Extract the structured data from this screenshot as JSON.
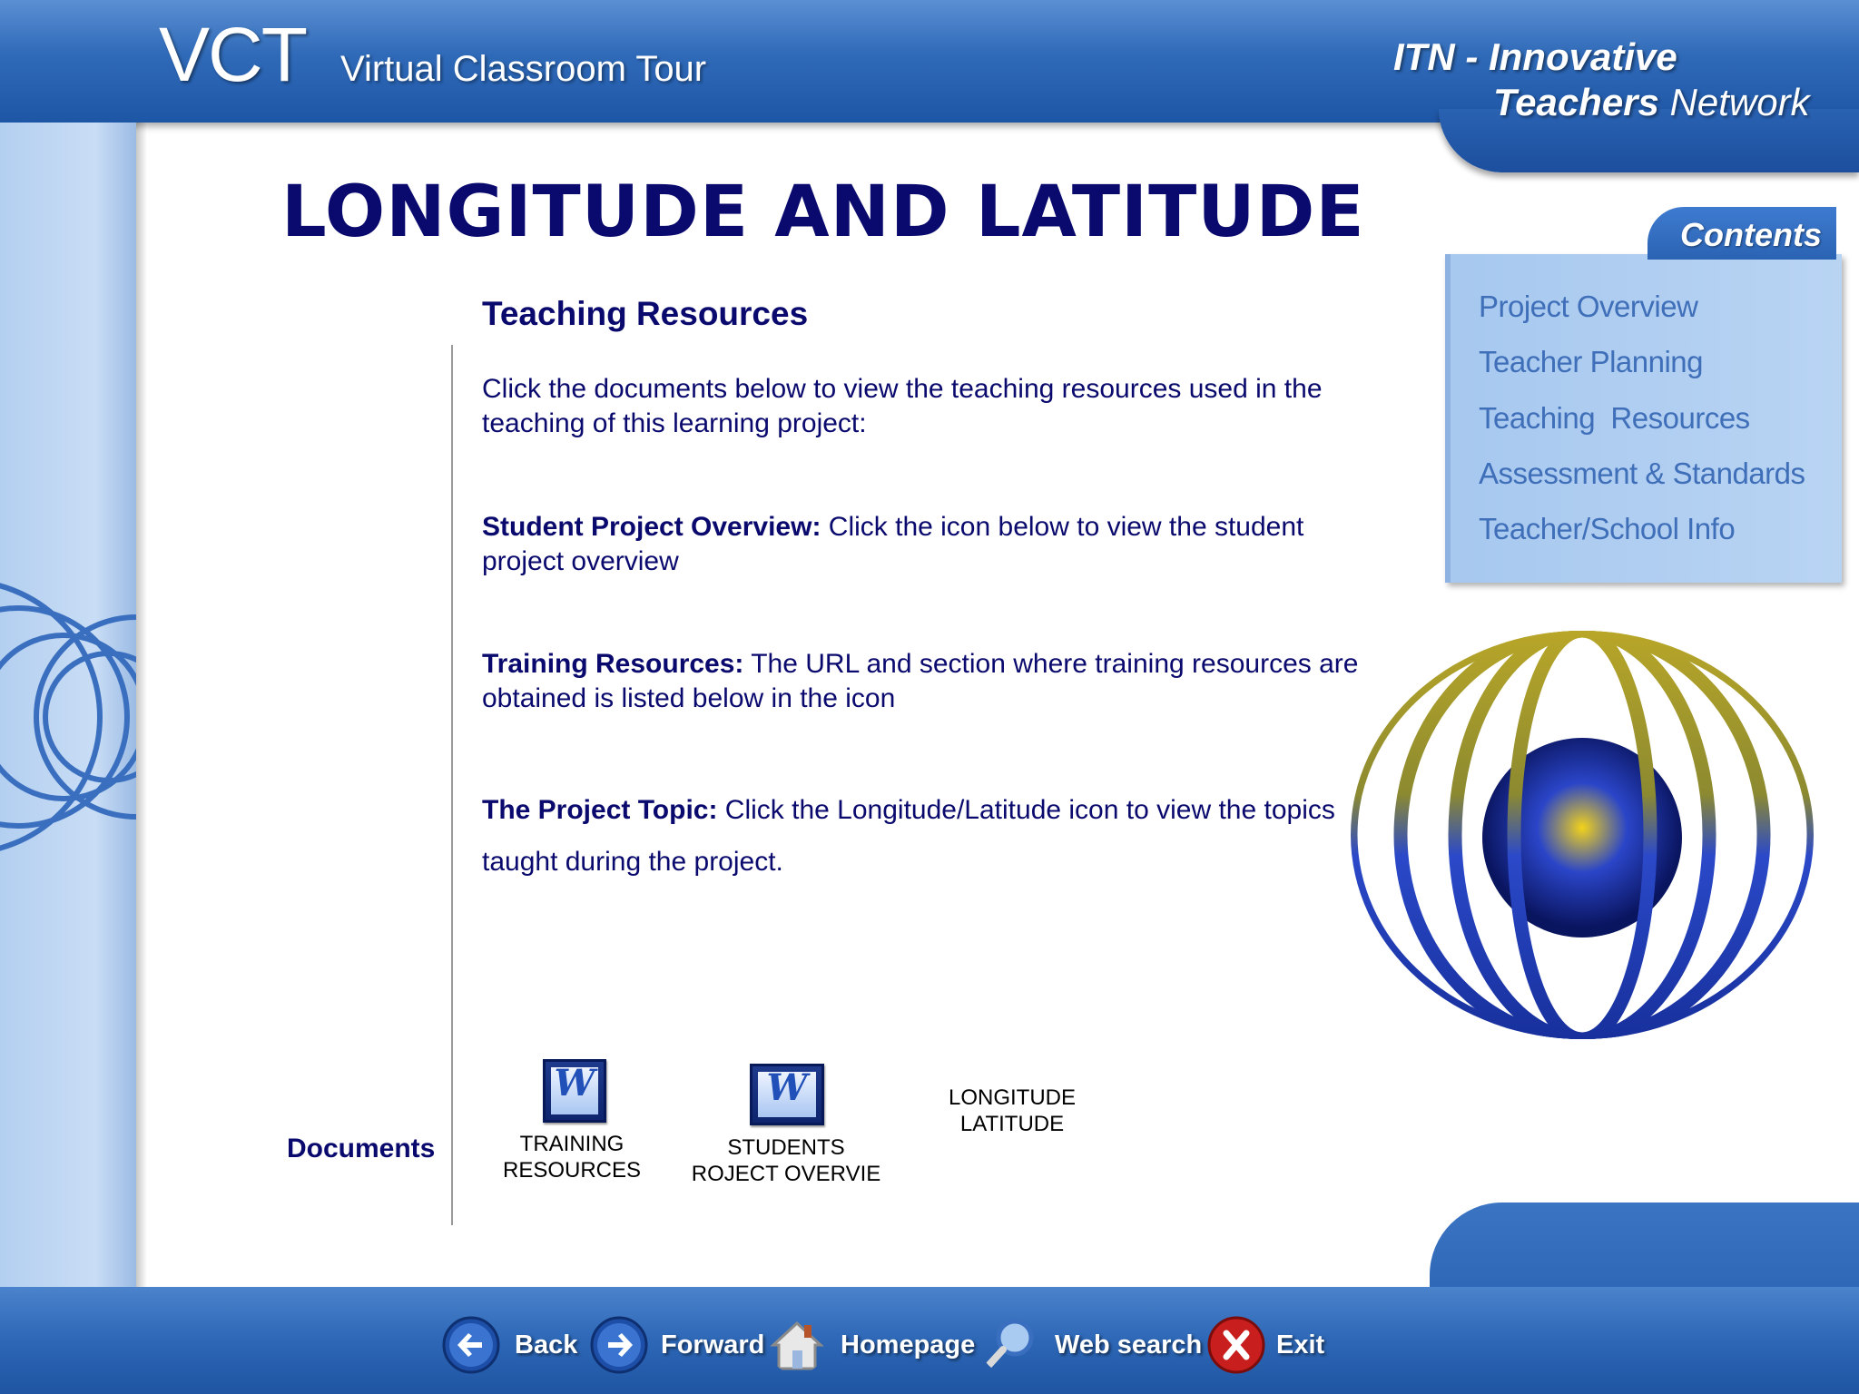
{
  "header": {
    "logo": "VCT",
    "subtitle": "Virtual Classroom Tour",
    "network_line1": "ITN - Innovative",
    "network_line2_bold": "Teachers",
    "network_line2_rest": " Network"
  },
  "page": {
    "title": "LONGITUDE AND LATITUDE",
    "section_heading": "Teaching Resources",
    "intro": "Click the documents below to view the teaching resources used in the teaching of this learning project:",
    "student_overview": {
      "label": "Student Project Overview:",
      "text": "  Click the icon below to view the student project overview"
    },
    "training": {
      "label": "Training Resources:",
      "text": "  The URL and section where training resources are obtained is listed below in the icon"
    },
    "topic": {
      "label": "The Project Topic:",
      "text": " Click the Longitude/Latitude icon to view the topics taught during the project."
    },
    "documents_label": "Documents",
    "documents": [
      {
        "icon": "word-doc-icon",
        "line1": "TRAINING",
        "line2": "RESOURCES"
      },
      {
        "icon": "word-doc-icon",
        "line1": "STUDENTS",
        "line2": "ROJECT OVERVIE"
      },
      {
        "icon": "none",
        "line1": "LONGITUDE",
        "line2": "LATITUDE"
      }
    ]
  },
  "contents": {
    "title": "Contents",
    "items": [
      "Project Overview",
      "Teacher Planning",
      "Teaching  Resources",
      "Assessment & Standards",
      "Teacher/School Info"
    ]
  },
  "footer_nav": [
    {
      "label": "Back",
      "icon": "back-arrow-icon"
    },
    {
      "label": "Forward",
      "icon": "forward-arrow-icon"
    },
    {
      "label": "Homepage",
      "icon": "home-icon"
    },
    {
      "label": "Web search",
      "icon": "magnifier-icon"
    },
    {
      "label": "Exit",
      "icon": "exit-icon"
    }
  ],
  "colors": {
    "title_navy": "#0a0a6e",
    "header_blue": "#2f6ab8",
    "panel_blue": "#b9d4f3",
    "link_blue": "#3f6fb9"
  }
}
